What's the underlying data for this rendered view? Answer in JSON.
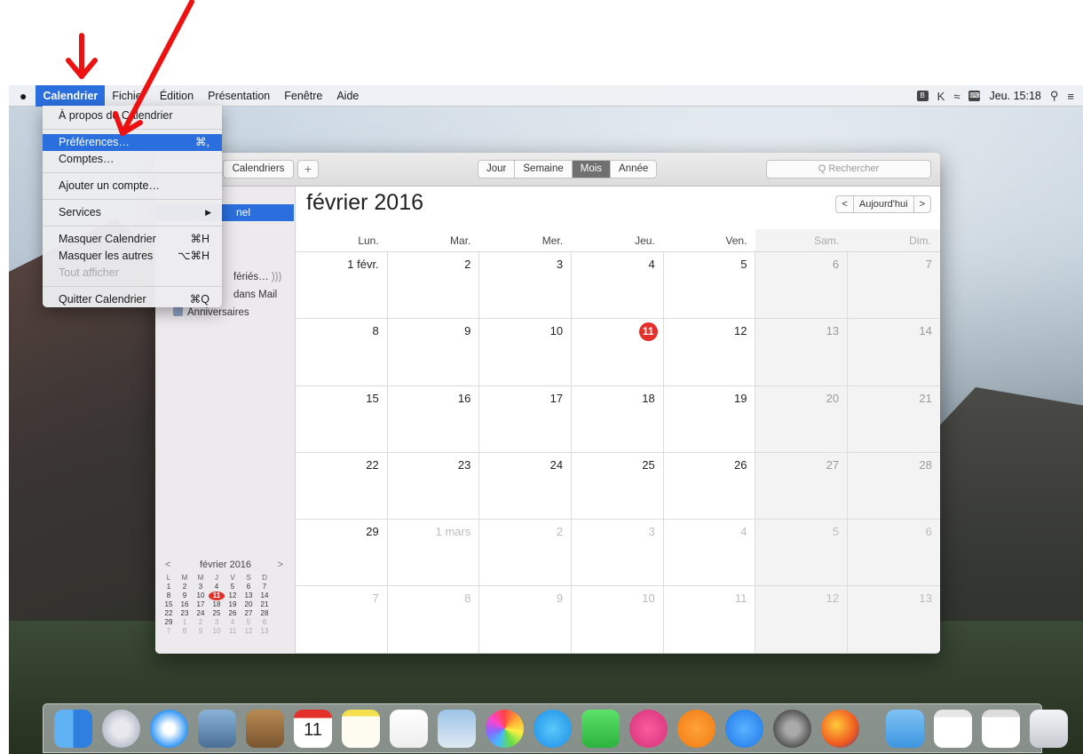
{
  "menubar": {
    "apple_glyph": "",
    "items": [
      "Calendrier",
      "Fichier",
      "Édition",
      "Présentation",
      "Fenêtre",
      "Aide"
    ],
    "clock": "Jeu. 15:18",
    "status_icons": [
      "B",
      "K",
      "wifi-icon",
      "keyboard-icon",
      "search-icon",
      "list-icon"
    ]
  },
  "dropdown": {
    "items": [
      {
        "label": "À propos de Calendrier",
        "shortcut": ""
      },
      {
        "label": "Préférences…",
        "shortcut": "⌘,"
      },
      {
        "label": "Comptes…",
        "shortcut": ""
      },
      {
        "label": "Ajouter un compte…",
        "shortcut": ""
      },
      {
        "label": "Services",
        "shortcut": "▶"
      },
      {
        "label": "Masquer Calendrier",
        "shortcut": "⌘H"
      },
      {
        "label": "Masquer les autres",
        "shortcut": "⌥⌘H"
      },
      {
        "label": "Tout afficher",
        "shortcut": ""
      },
      {
        "label": "Quitter Calendrier",
        "shortcut": "⌘Q"
      }
    ]
  },
  "toolbar": {
    "calendars_label": "Calendriers",
    "add_label": "+",
    "views": [
      "Jour",
      "Semaine",
      "Mois",
      "Année"
    ],
    "active_view": "Mois",
    "search_placeholder": "Q Rechercher"
  },
  "sidebar": {
    "selected_label": "nel",
    "items": [
      "fériés… ",
      "dans Mail",
      "Anniversaires"
    ]
  },
  "mini_calendar": {
    "title": "février 2016",
    "prev": "<",
    "next": ">",
    "weekdays": [
      "L",
      "M",
      "M",
      "J",
      "V",
      "S",
      "D"
    ],
    "weeks": [
      [
        "1",
        "2",
        "3",
        "4",
        "5",
        "6",
        "7"
      ],
      [
        "8",
        "9",
        "10",
        "11",
        "12",
        "13",
        "14"
      ],
      [
        "15",
        "16",
        "17",
        "18",
        "19",
        "20",
        "21"
      ],
      [
        "22",
        "23",
        "24",
        "25",
        "26",
        "27",
        "28"
      ],
      [
        "29",
        "1",
        "2",
        "3",
        "4",
        "5",
        "6"
      ],
      [
        "7",
        "8",
        "9",
        "10",
        "11",
        "12",
        "13"
      ]
    ]
  },
  "main": {
    "month_title": "février 2016",
    "nav_prev": "<",
    "today_label": "Aujourd'hui",
    "nav_next": ">",
    "weekdays": [
      "Lun.",
      "Mar.",
      "Mer.",
      "Jeu.",
      "Ven.",
      "Sam.",
      "Dim."
    ],
    "weeks": [
      [
        "1 févr.",
        "2",
        "3",
        "4",
        "5",
        "6",
        "7"
      ],
      [
        "8",
        "9",
        "10",
        "11",
        "12",
        "13",
        "14"
      ],
      [
        "15",
        "16",
        "17",
        "18",
        "19",
        "20",
        "21"
      ],
      [
        "22",
        "23",
        "24",
        "25",
        "26",
        "27",
        "28"
      ],
      [
        "29",
        "1 mars",
        "2",
        "3",
        "4",
        "5",
        "6"
      ],
      [
        "7",
        "8",
        "9",
        "10",
        "11",
        "12",
        "13"
      ]
    ],
    "today": "11"
  },
  "dock": {
    "calendar_icon_day": "11",
    "apps": [
      "finder-icon",
      "launchpad-icon",
      "safari-icon",
      "mail-icon",
      "contacts-icon",
      "calendar-icon",
      "notes-icon",
      "reminders-icon",
      "preview-icon",
      "photos-icon",
      "messages-icon",
      "facetime-icon",
      "itunes-icon",
      "ibooks-icon",
      "appstore-icon",
      "preferences-icon",
      "firefox-icon",
      "downloads-folder-icon",
      "window-icon",
      "window2-icon",
      "trash-icon"
    ]
  },
  "colors": {
    "accent": "#2b6fde",
    "today_red": "#e4302a",
    "annotation_red": "#ee1111"
  }
}
